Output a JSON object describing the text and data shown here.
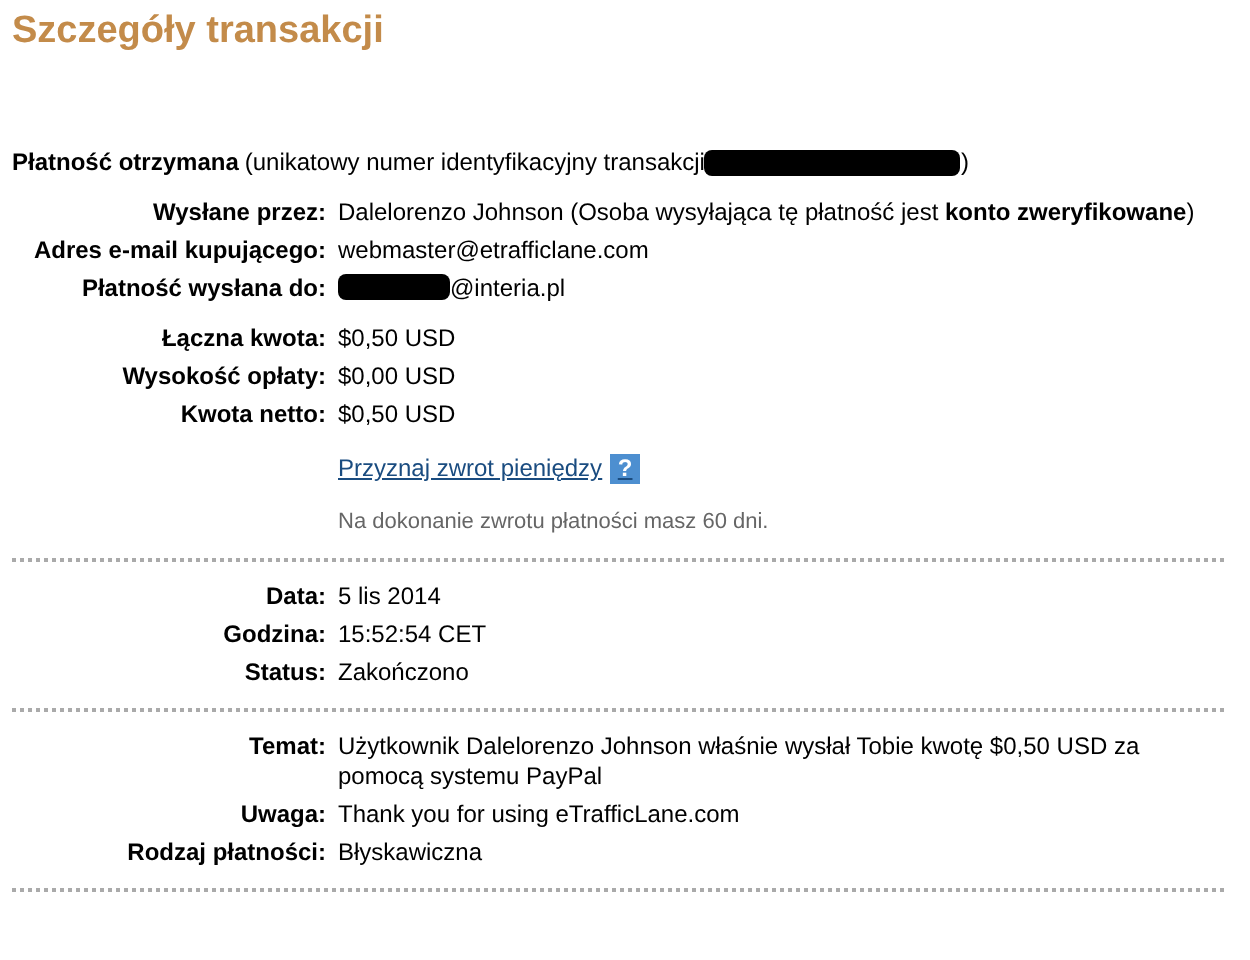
{
  "title": "Szczegóły transakcji",
  "header": {
    "label": "Płatność otrzymana",
    "text": "(unikatowy numer identyfikacyjny transakcji",
    "redacted": true,
    "text_after": ")"
  },
  "sections": [
    {
      "divider": false,
      "rows": [
        {
          "kind": "field",
          "label": "Wysłane przez:",
          "value": "Dalelorenzo Johnson (Osoba wysyłająca tę płatność jest **konto zweryfikowane**)",
          "redacted": false
        },
        {
          "kind": "field",
          "label": "Adres e-mail kupującego:",
          "value": "webmaster@etrafficlane.com",
          "redacted": false
        },
        {
          "kind": "field",
          "label": "Płatność wysłana do:",
          "value": "@interia.pl",
          "redacted": true
        }
      ]
    },
    {
      "divider": true,
      "rows": [
        {
          "kind": "field",
          "label": "Łączna kwota:",
          "value": "$0,50 USD",
          "redacted": false
        },
        {
          "kind": "field",
          "label": "Wysokość opłaty:",
          "value": "$0,00 USD",
          "redacted": false
        },
        {
          "kind": "field",
          "label": "Kwota netto:",
          "value": "$0,50 USD",
          "redacted": false
        },
        {
          "kind": "link",
          "value": "Przyznaj zwrot pieniędzy",
          "help": "?"
        },
        {
          "kind": "note",
          "value": "Na dokonanie zwrotu płatności masz 60 dni."
        }
      ]
    },
    {
      "divider": true,
      "rows": [
        {
          "kind": "field",
          "label": "Data:",
          "value": "5 lis 2014",
          "redacted": false
        },
        {
          "kind": "field",
          "label": "Godzina:",
          "value": "15:52:54 CET",
          "redacted": false
        },
        {
          "kind": "field",
          "label": "Status:",
          "value": "Zakończono",
          "redacted": false
        }
      ]
    },
    {
      "divider": true,
      "rows": [
        {
          "kind": "field",
          "label": "Temat:",
          "value": "Użytkownik Dalelorenzo Johnson właśnie wysłał Tobie kwotę $0,50 USD za pomocą systemu PayPal",
          "redacted": false
        },
        {
          "kind": "field",
          "label": "Uwaga:",
          "value": "Thank you for using eTrafficLane.com",
          "redacted": false
        },
        {
          "kind": "field",
          "label": "Rodzaj płatności:",
          "value": "Błyskawiczna",
          "redacted": false
        }
      ]
    }
  ]
}
